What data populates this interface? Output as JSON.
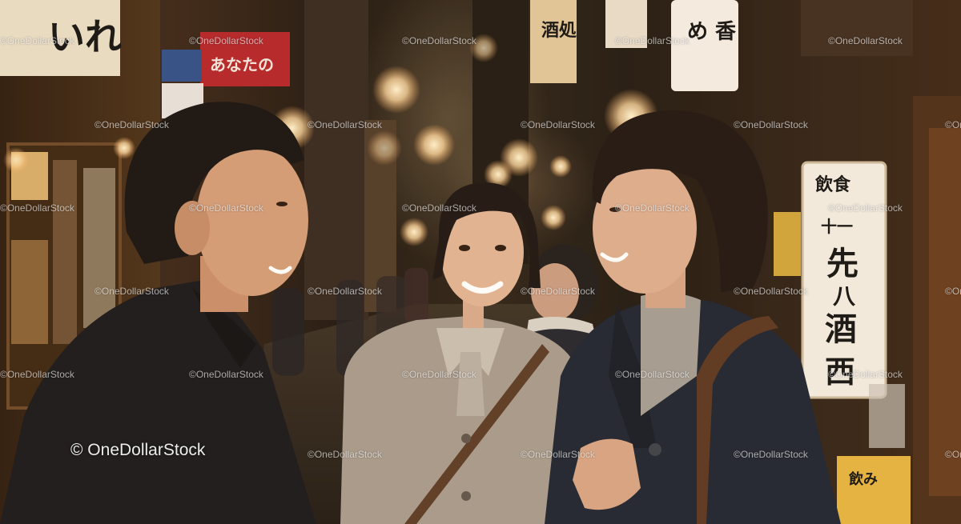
{
  "watermark": {
    "text": "©OneDollarStock",
    "large_text": "© OneDollarStock"
  },
  "signs": {
    "top_left": "いれ",
    "top_center_red": "あなたの",
    "top_center_tall": "酒処",
    "top_right": "め 香",
    "right_large": [
      "飲食",
      "十一",
      "先",
      "八",
      "酒",
      "西"
    ],
    "bottom_right": "飲み"
  },
  "colors": {
    "lantern": "#ffd9a0",
    "coat_beige": "#a59a8d",
    "coat_dark": "#1b2230",
    "jacket_black": "#15161a",
    "sign_red": "#b3232a"
  }
}
